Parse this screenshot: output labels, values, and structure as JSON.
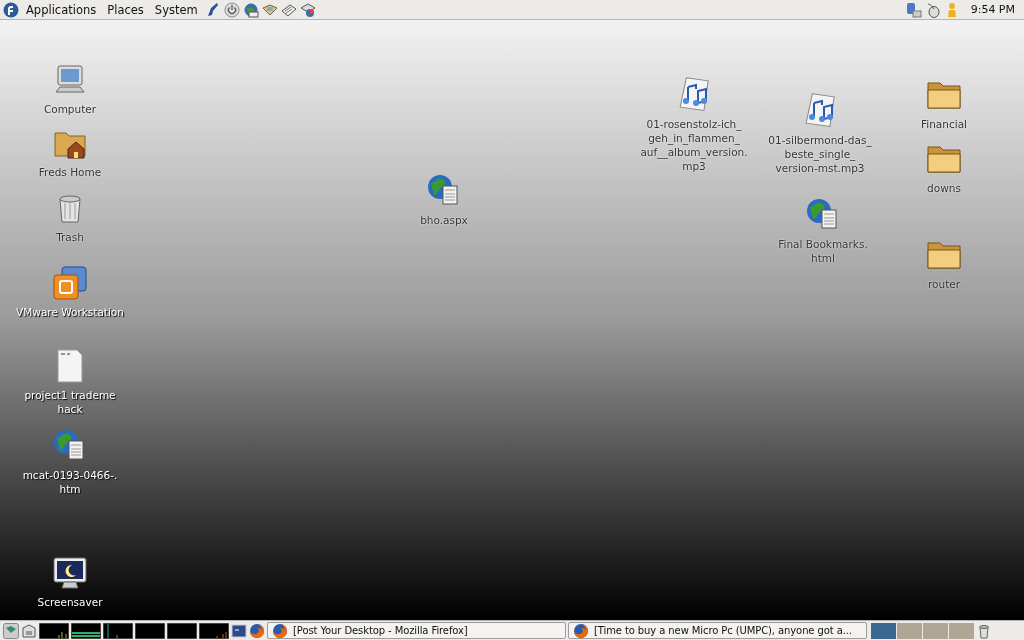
{
  "top_panel": {
    "menus": [
      "Applications",
      "Places",
      "System"
    ],
    "clock": "9:54 PM"
  },
  "desktop_icons": [
    {
      "kind": "computer",
      "lines": [
        "Computer"
      ]
    },
    {
      "kind": "home",
      "lines": [
        "Freds Home"
      ]
    },
    {
      "kind": "trash",
      "lines": [
        "Trash"
      ]
    },
    {
      "kind": "vmware",
      "lines": [
        "VMware Workstation"
      ]
    },
    {
      "kind": "text",
      "lines": [
        "project1 trademe",
        "hack"
      ]
    },
    {
      "kind": "web",
      "lines": [
        "mcat-0193-0466-.",
        "htm"
      ]
    },
    {
      "kind": "screensaver",
      "lines": [
        "Screensaver"
      ]
    },
    {
      "kind": "web",
      "lines": [
        "bho.aspx"
      ]
    },
    {
      "kind": "audio",
      "lines": [
        "01-rosenstolz-ich_",
        "geh_in_flammen_",
        "auf__album_version.",
        "mp3"
      ]
    },
    {
      "kind": "audio",
      "lines": [
        "01-silbermond-das_",
        "beste_single_",
        "version-mst.mp3"
      ]
    },
    {
      "kind": "web",
      "lines": [
        "Final Bookmarks.",
        "html"
      ]
    },
    {
      "kind": "folder",
      "lines": [
        "Financial"
      ]
    },
    {
      "kind": "folder",
      "lines": [
        "downs"
      ]
    },
    {
      "kind": "folder",
      "lines": [
        "router"
      ]
    }
  ],
  "bottom_panel": {
    "tasks": [
      {
        "title": "[Post Your Desktop - Mozilla Firefox]"
      },
      {
        "title": "[Time to buy a new Micro Pc (UMPC), anyone got a..."
      }
    ],
    "workspaces": [
      {
        "selected": true
      },
      {
        "selected": false
      },
      {
        "selected": false
      },
      {
        "selected": false
      }
    ]
  }
}
